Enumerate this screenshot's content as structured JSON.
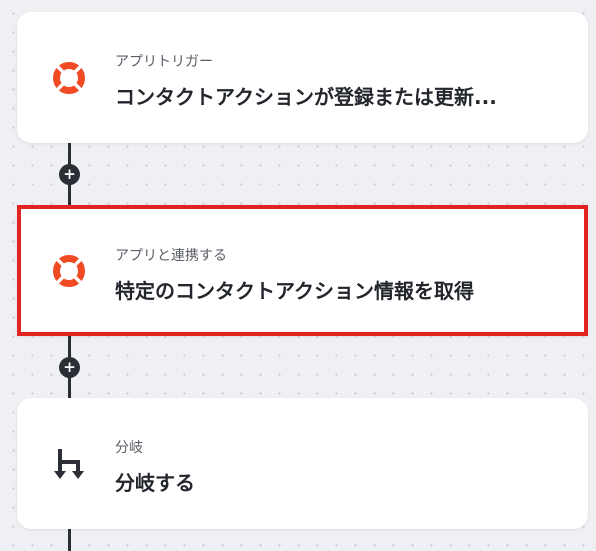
{
  "nodes": [
    {
      "subtitle": "アプリトリガー",
      "title": "コンタクトアクションが登録または更新...",
      "icon": "lifebuoy-icon"
    },
    {
      "subtitle": "アプリと連携する",
      "title": "特定のコンタクトアクション情報を取得",
      "icon": "lifebuoy-icon",
      "selected": true
    },
    {
      "subtitle": "分岐",
      "title": "分岐する",
      "icon": "branch-icon"
    }
  ],
  "add_step_symbol": "+",
  "colors": {
    "accent_orange": "#f04b24",
    "selection_red": "#e2231f",
    "dark": "#2b2e35"
  }
}
